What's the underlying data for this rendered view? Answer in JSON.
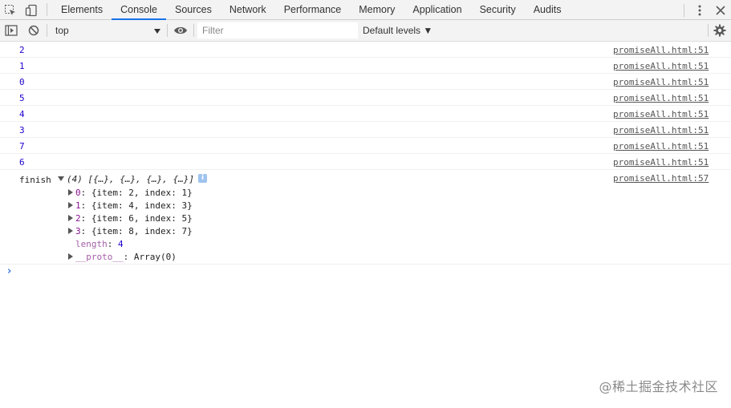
{
  "tabs": [
    "Elements",
    "Console",
    "Sources",
    "Network",
    "Performance",
    "Memory",
    "Application",
    "Security",
    "Audits"
  ],
  "active_tab": "Console",
  "toolbar": {
    "context": "top",
    "filter_placeholder": "Filter",
    "levels": "Default levels ▼"
  },
  "log": {
    "numbers": [
      {
        "value": "2",
        "source": "promiseAll.html:51"
      },
      {
        "value": "1",
        "source": "promiseAll.html:51"
      },
      {
        "value": "0",
        "source": "promiseAll.html:51"
      },
      {
        "value": "5",
        "source": "promiseAll.html:51"
      },
      {
        "value": "4",
        "source": "promiseAll.html:51"
      },
      {
        "value": "3",
        "source": "promiseAll.html:51"
      },
      {
        "value": "7",
        "source": "promiseAll.html:51"
      },
      {
        "value": "6",
        "source": "promiseAll.html:51"
      }
    ],
    "finish": {
      "label": "finish",
      "summary": "(4) [{…}, {…}, {…}, {…}]",
      "source": "promiseAll.html:57",
      "items": [
        {
          "key": "0",
          "value": "{item: 2, index: 1}"
        },
        {
          "key": "1",
          "value": "{item: 4, index: 3}"
        },
        {
          "key": "2",
          "value": "{item: 6, index: 5}"
        },
        {
          "key": "3",
          "value": "{item: 8, index: 7}"
        }
      ],
      "length_key": "length",
      "length_value": "4",
      "proto_key": "__proto__",
      "proto_value": "Array(0)"
    }
  },
  "watermark": "@稀土掘金技术社区"
}
